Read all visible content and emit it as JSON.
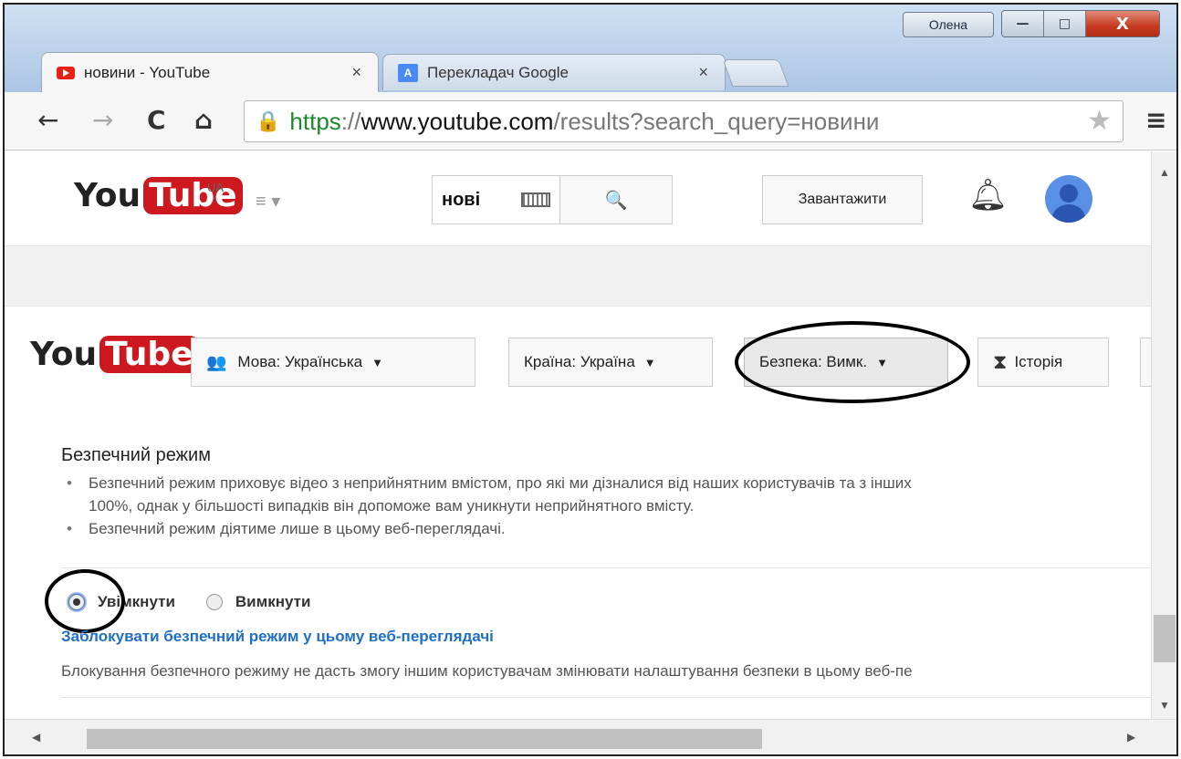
{
  "window": {
    "profile_name": "Олена",
    "minimize": "—",
    "maximize": "□",
    "close": "X"
  },
  "tabs": [
    {
      "label": "новини - YouTube",
      "close": "×",
      "active": true
    },
    {
      "label": "Перекладач Google",
      "close": "×",
      "active": false
    }
  ],
  "toolbar": {
    "back": "←",
    "forward": "→",
    "reload": "C",
    "home": "⌂",
    "url_scheme": "https",
    "url_sep": "://",
    "url_host": "www.youtube.com",
    "url_path": "/results?search_query=новини",
    "star": "★",
    "menu": "≡"
  },
  "header": {
    "logo_you": "You",
    "logo_tube": "Tube",
    "country_code": "UA",
    "guide": "≡ ▾",
    "search_value": "нові",
    "search_icon": "🔍",
    "upload_label": "Завантажити"
  },
  "footer": {
    "logo_you": "You",
    "logo_tube": "Tube",
    "language_label": "Мова: Українська",
    "country_label": "Країна: Україна",
    "safety_label": "Безпека: Вимк.",
    "history_label": "Історія",
    "caret": "▼"
  },
  "safety": {
    "title": "Безпечний режим",
    "bullets": [
      "Безпечний режим приховує відео з неприйнятним вмістом, про які ми дізналися від наших користувачів та з інших",
      "100%, однак у більшості випадків він допоможе вам уникнути неприйнятного вмісту.",
      "Безпечний режим діятиме лише в цьому веб-переглядачі."
    ],
    "option_on": "Увімкнути",
    "option_off": "Вимкнути",
    "selected": "on",
    "lock_link": "Заблокувати безпечний режим у цьому веб-переглядачі",
    "lock_desc": "Блокування безпечного режиму не дасть змогу іншим користувачам змінювати налаштування безпеки в цьому веб-пе"
  },
  "colors": {
    "youtube_red": "#cc181e",
    "link_blue": "#1f6fc5",
    "https_green": "#1a8a2a"
  },
  "icons": {
    "lock": "lock-icon",
    "bell": "bell-icon",
    "keyboard": "keyboard-icon",
    "hourglass": "hourglass-icon",
    "language": "people-icon"
  }
}
